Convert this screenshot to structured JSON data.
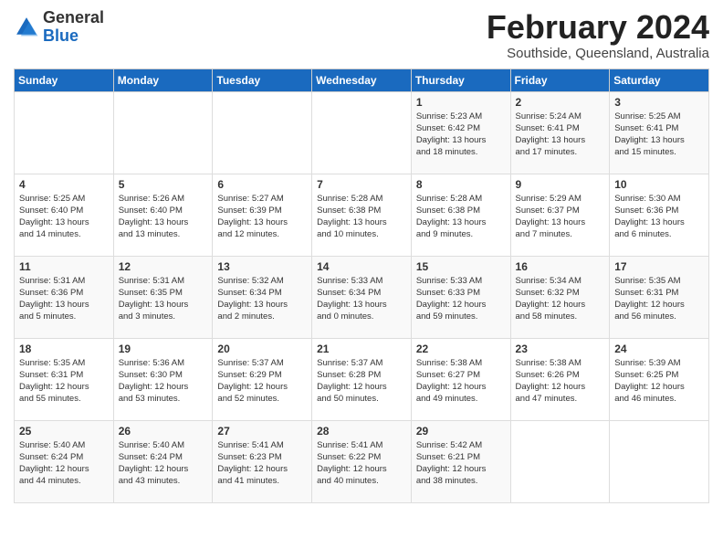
{
  "logo": {
    "general": "General",
    "blue": "Blue"
  },
  "title": "February 2024",
  "subtitle": "Southside, Queensland, Australia",
  "days_header": [
    "Sunday",
    "Monday",
    "Tuesday",
    "Wednesday",
    "Thursday",
    "Friday",
    "Saturday"
  ],
  "weeks": [
    [
      {
        "day": "",
        "info": ""
      },
      {
        "day": "",
        "info": ""
      },
      {
        "day": "",
        "info": ""
      },
      {
        "day": "",
        "info": ""
      },
      {
        "day": "1",
        "info": "Sunrise: 5:23 AM\nSunset: 6:42 PM\nDaylight: 13 hours\nand 18 minutes."
      },
      {
        "day": "2",
        "info": "Sunrise: 5:24 AM\nSunset: 6:41 PM\nDaylight: 13 hours\nand 17 minutes."
      },
      {
        "day": "3",
        "info": "Sunrise: 5:25 AM\nSunset: 6:41 PM\nDaylight: 13 hours\nand 15 minutes."
      }
    ],
    [
      {
        "day": "4",
        "info": "Sunrise: 5:25 AM\nSunset: 6:40 PM\nDaylight: 13 hours\nand 14 minutes."
      },
      {
        "day": "5",
        "info": "Sunrise: 5:26 AM\nSunset: 6:40 PM\nDaylight: 13 hours\nand 13 minutes."
      },
      {
        "day": "6",
        "info": "Sunrise: 5:27 AM\nSunset: 6:39 PM\nDaylight: 13 hours\nand 12 minutes."
      },
      {
        "day": "7",
        "info": "Sunrise: 5:28 AM\nSunset: 6:38 PM\nDaylight: 13 hours\nand 10 minutes."
      },
      {
        "day": "8",
        "info": "Sunrise: 5:28 AM\nSunset: 6:38 PM\nDaylight: 13 hours\nand 9 minutes."
      },
      {
        "day": "9",
        "info": "Sunrise: 5:29 AM\nSunset: 6:37 PM\nDaylight: 13 hours\nand 7 minutes."
      },
      {
        "day": "10",
        "info": "Sunrise: 5:30 AM\nSunset: 6:36 PM\nDaylight: 13 hours\nand 6 minutes."
      }
    ],
    [
      {
        "day": "11",
        "info": "Sunrise: 5:31 AM\nSunset: 6:36 PM\nDaylight: 13 hours\nand 5 minutes."
      },
      {
        "day": "12",
        "info": "Sunrise: 5:31 AM\nSunset: 6:35 PM\nDaylight: 13 hours\nand 3 minutes."
      },
      {
        "day": "13",
        "info": "Sunrise: 5:32 AM\nSunset: 6:34 PM\nDaylight: 13 hours\nand 2 minutes."
      },
      {
        "day": "14",
        "info": "Sunrise: 5:33 AM\nSunset: 6:34 PM\nDaylight: 13 hours\nand 0 minutes."
      },
      {
        "day": "15",
        "info": "Sunrise: 5:33 AM\nSunset: 6:33 PM\nDaylight: 12 hours\nand 59 minutes."
      },
      {
        "day": "16",
        "info": "Sunrise: 5:34 AM\nSunset: 6:32 PM\nDaylight: 12 hours\nand 58 minutes."
      },
      {
        "day": "17",
        "info": "Sunrise: 5:35 AM\nSunset: 6:31 PM\nDaylight: 12 hours\nand 56 minutes."
      }
    ],
    [
      {
        "day": "18",
        "info": "Sunrise: 5:35 AM\nSunset: 6:31 PM\nDaylight: 12 hours\nand 55 minutes."
      },
      {
        "day": "19",
        "info": "Sunrise: 5:36 AM\nSunset: 6:30 PM\nDaylight: 12 hours\nand 53 minutes."
      },
      {
        "day": "20",
        "info": "Sunrise: 5:37 AM\nSunset: 6:29 PM\nDaylight: 12 hours\nand 52 minutes."
      },
      {
        "day": "21",
        "info": "Sunrise: 5:37 AM\nSunset: 6:28 PM\nDaylight: 12 hours\nand 50 minutes."
      },
      {
        "day": "22",
        "info": "Sunrise: 5:38 AM\nSunset: 6:27 PM\nDaylight: 12 hours\nand 49 minutes."
      },
      {
        "day": "23",
        "info": "Sunrise: 5:38 AM\nSunset: 6:26 PM\nDaylight: 12 hours\nand 47 minutes."
      },
      {
        "day": "24",
        "info": "Sunrise: 5:39 AM\nSunset: 6:25 PM\nDaylight: 12 hours\nand 46 minutes."
      }
    ],
    [
      {
        "day": "25",
        "info": "Sunrise: 5:40 AM\nSunset: 6:24 PM\nDaylight: 12 hours\nand 44 minutes."
      },
      {
        "day": "26",
        "info": "Sunrise: 5:40 AM\nSunset: 6:24 PM\nDaylight: 12 hours\nand 43 minutes."
      },
      {
        "day": "27",
        "info": "Sunrise: 5:41 AM\nSunset: 6:23 PM\nDaylight: 12 hours\nand 41 minutes."
      },
      {
        "day": "28",
        "info": "Sunrise: 5:41 AM\nSunset: 6:22 PM\nDaylight: 12 hours\nand 40 minutes."
      },
      {
        "day": "29",
        "info": "Sunrise: 5:42 AM\nSunset: 6:21 PM\nDaylight: 12 hours\nand 38 minutes."
      },
      {
        "day": "",
        "info": ""
      },
      {
        "day": "",
        "info": ""
      }
    ]
  ]
}
